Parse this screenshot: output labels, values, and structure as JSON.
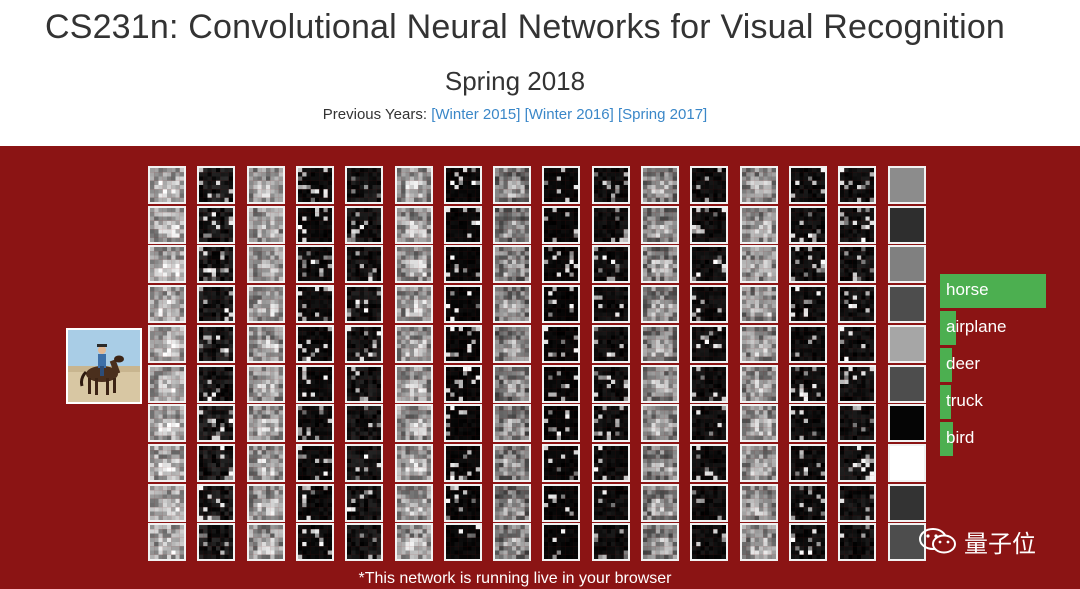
{
  "header": {
    "title": "CS231n: Convolutional Neural Networks for Visual Recognition",
    "term": "Spring 2018",
    "previous_label": "Previous Years:",
    "previous_links": [
      "[Winter 2015]",
      "[Winter 2016]",
      "[Spring 2017]"
    ]
  },
  "banner": {
    "background_color": "#8b1414",
    "input_image_label": "input-image",
    "predictions": [
      {
        "label": "horse",
        "score": 0.8
      },
      {
        "label": "airplane",
        "score": 0.12
      },
      {
        "label": "deer",
        "score": 0.09
      },
      {
        "label": "truck",
        "score": 0.08
      },
      {
        "label": "bird",
        "score": 0.1
      }
    ],
    "bar_color": "#4caf50",
    "footnote": "*This network is running live in your browser"
  },
  "watermark": {
    "icon": "wechat-icon",
    "text": "量子位"
  }
}
